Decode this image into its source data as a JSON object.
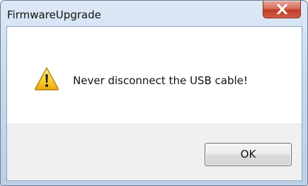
{
  "window": {
    "title": "FirmwareUpgrade"
  },
  "dialog": {
    "icon": "warning-icon",
    "message": "Never disconnect the USB cable!",
    "ok_label": "OK"
  },
  "colors": {
    "close_button": "#c23d28",
    "warning_yellow": "#f5c518"
  }
}
